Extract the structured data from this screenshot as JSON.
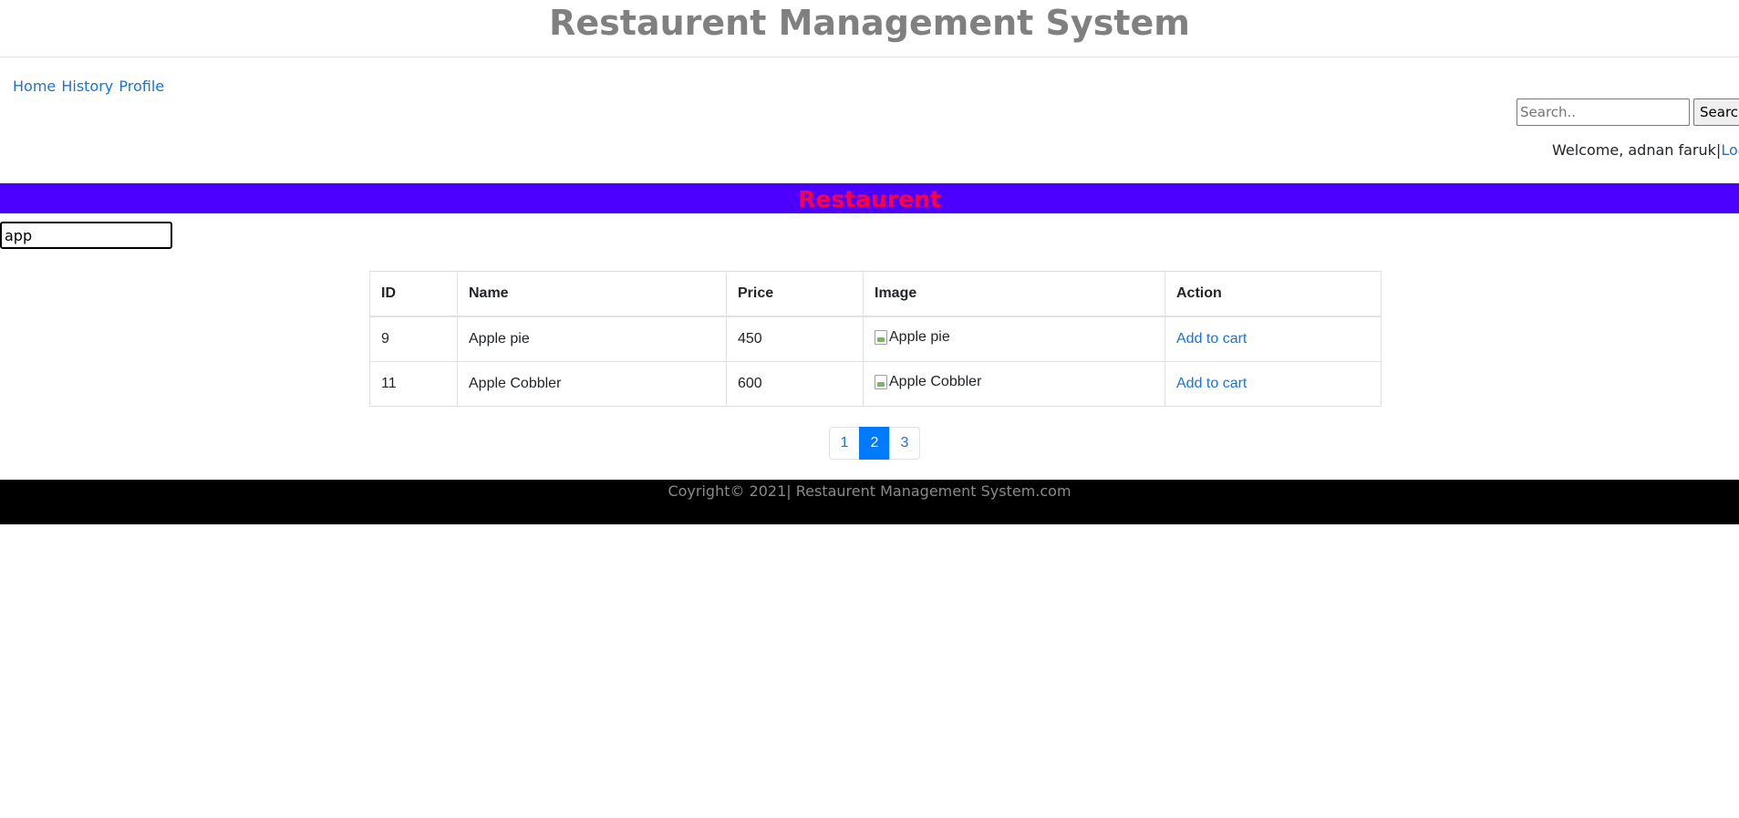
{
  "header": {
    "title": "Restaurent Management System"
  },
  "nav": {
    "items": [
      "Home",
      "History",
      "Profile"
    ]
  },
  "search": {
    "placeholder": "Search..",
    "button_label": "Search"
  },
  "user": {
    "welcome_text": "Welcome, adnan faruk",
    "separator": "|",
    "logout_label": "Log-out"
  },
  "banner": {
    "title": "Restaurent",
    "background": "#4c00ff",
    "text_color": "#ff0040"
  },
  "filter": {
    "value": "app"
  },
  "table": {
    "columns": [
      "ID",
      "Name",
      "Price",
      "Image",
      "Action"
    ],
    "rows": [
      {
        "id": "9",
        "name": "Apple pie",
        "price": "450",
        "image_alt": "Apple pie",
        "action": "Add to cart"
      },
      {
        "id": "11",
        "name": "Apple Cobbler",
        "price": "600",
        "image_alt": "Apple Cobbler",
        "action": "Add to cart"
      }
    ]
  },
  "pagination": {
    "pages": [
      "1",
      "2",
      "3"
    ],
    "current": "2",
    "active_color": "#007bff"
  },
  "footer": {
    "text": "Coyright© 2021| Restaurent Management System.com"
  }
}
